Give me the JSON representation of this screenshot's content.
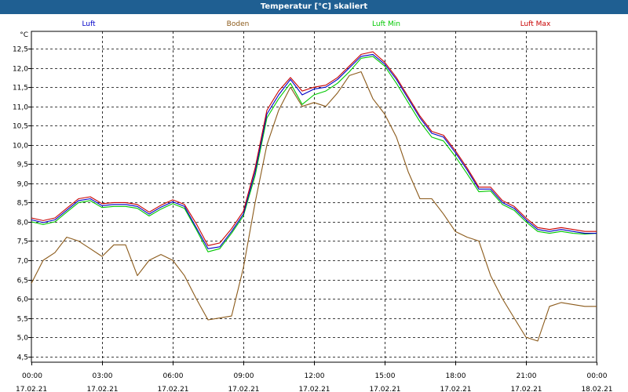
{
  "title": "Temperatur [°C] skaliert",
  "chart_data": {
    "type": "line",
    "title": "Temperatur [°C] skaliert",
    "ylabel": "°C",
    "ylim": [
      4.35,
      12.95
    ],
    "grid": true,
    "legend_placement": "top",
    "y_ticks": [
      "12,5",
      "12,0",
      "11,5",
      "11,0",
      "10,5",
      "10,0",
      "9,5",
      "9,0",
      "8,5",
      "8,0",
      "7,5",
      "7,0",
      "6,5",
      "6,0",
      "5,5",
      "5,0",
      "4,5"
    ],
    "y_tick_values": [
      12.5,
      12.0,
      11.5,
      11.0,
      10.5,
      10.0,
      9.5,
      9.0,
      8.5,
      8.0,
      7.5,
      7.0,
      6.5,
      6.0,
      5.5,
      5.0,
      4.5
    ],
    "x_ticks": [
      {
        "time": "00:00",
        "date": "17.02.21"
      },
      {
        "time": "03:00",
        "date": "17.02.21"
      },
      {
        "time": "06:00",
        "date": "17.02.21"
      },
      {
        "time": "09:00",
        "date": "17.02.21"
      },
      {
        "time": "12:00",
        "date": "17.02.21"
      },
      {
        "time": "15:00",
        "date": "17.02.21"
      },
      {
        "time": "18:00",
        "date": "17.02.21"
      },
      {
        "time": "21:00",
        "date": "17.02.21"
      },
      {
        "time": "00:00",
        "date": "18.02.21"
      }
    ],
    "x": [
      0,
      0.5,
      1,
      1.5,
      2,
      2.5,
      3,
      3.5,
      4,
      4.5,
      5,
      5.5,
      6,
      6.5,
      7,
      7.5,
      8,
      8.5,
      9,
      9.5,
      10,
      10.5,
      11,
      11.5,
      12,
      12.5,
      13,
      13.5,
      14,
      14.5,
      15,
      15.5,
      16,
      16.5,
      17,
      17.5,
      18,
      18.5,
      19,
      19.5,
      20,
      20.5,
      21,
      21.5,
      22,
      22.5,
      23,
      23.5,
      24
    ],
    "series": [
      {
        "name": "Luft",
        "color": "#0000c8",
        "values": [
          8.05,
          7.98,
          8.05,
          8.3,
          8.55,
          8.6,
          8.42,
          8.45,
          8.45,
          8.4,
          8.2,
          8.38,
          8.52,
          8.4,
          7.85,
          7.3,
          7.35,
          7.75,
          8.2,
          9.3,
          10.8,
          11.3,
          11.7,
          11.3,
          11.45,
          11.5,
          11.7,
          12.0,
          12.3,
          12.35,
          12.1,
          11.7,
          11.2,
          10.7,
          10.3,
          10.2,
          9.8,
          9.35,
          8.85,
          8.85,
          8.5,
          8.35,
          8.05,
          7.8,
          7.75,
          7.8,
          7.75,
          7.7,
          7.7
        ]
      },
      {
        "name": "Boden",
        "color": "#8b5a1a",
        "values": [
          6.4,
          7.0,
          7.2,
          7.6,
          7.5,
          7.3,
          7.1,
          7.4,
          7.4,
          6.6,
          7.0,
          7.15,
          7.0,
          6.6,
          6.0,
          5.45,
          5.5,
          5.55,
          6.8,
          8.5,
          10.0,
          10.9,
          11.5,
          11.0,
          11.1,
          11.0,
          11.35,
          11.8,
          11.9,
          11.2,
          10.8,
          10.2,
          9.3,
          8.6,
          8.6,
          8.2,
          7.75,
          7.6,
          7.5,
          6.6,
          6.0,
          5.5,
          5.0,
          4.9,
          5.8,
          5.9,
          5.85,
          5.8,
          5.8
        ]
      },
      {
        "name": "Luft Min",
        "color": "#00c800",
        "values": [
          8.0,
          7.93,
          8.0,
          8.25,
          8.5,
          8.55,
          8.37,
          8.4,
          8.4,
          8.35,
          8.15,
          8.33,
          8.47,
          8.35,
          7.8,
          7.22,
          7.3,
          7.7,
          8.15,
          9.2,
          10.7,
          11.2,
          11.6,
          11.05,
          11.3,
          11.4,
          11.6,
          11.9,
          12.25,
          12.3,
          12.05,
          11.6,
          11.1,
          10.6,
          10.2,
          10.1,
          9.7,
          9.25,
          8.78,
          8.8,
          8.45,
          8.3,
          8.0,
          7.75,
          7.7,
          7.75,
          7.7,
          7.68,
          7.7
        ]
      },
      {
        "name": "Luft Max",
        "color": "#c80000",
        "values": [
          8.1,
          8.03,
          8.1,
          8.35,
          8.6,
          8.65,
          8.47,
          8.5,
          8.5,
          8.45,
          8.25,
          8.43,
          8.57,
          8.45,
          7.95,
          7.38,
          7.45,
          7.82,
          8.27,
          9.4,
          10.9,
          11.4,
          11.75,
          11.4,
          11.5,
          11.55,
          11.75,
          12.05,
          12.35,
          12.42,
          12.15,
          11.75,
          11.25,
          10.75,
          10.35,
          10.25,
          9.85,
          9.4,
          8.9,
          8.9,
          8.55,
          8.4,
          8.1,
          7.85,
          7.8,
          7.85,
          7.8,
          7.75,
          7.75
        ]
      }
    ]
  }
}
